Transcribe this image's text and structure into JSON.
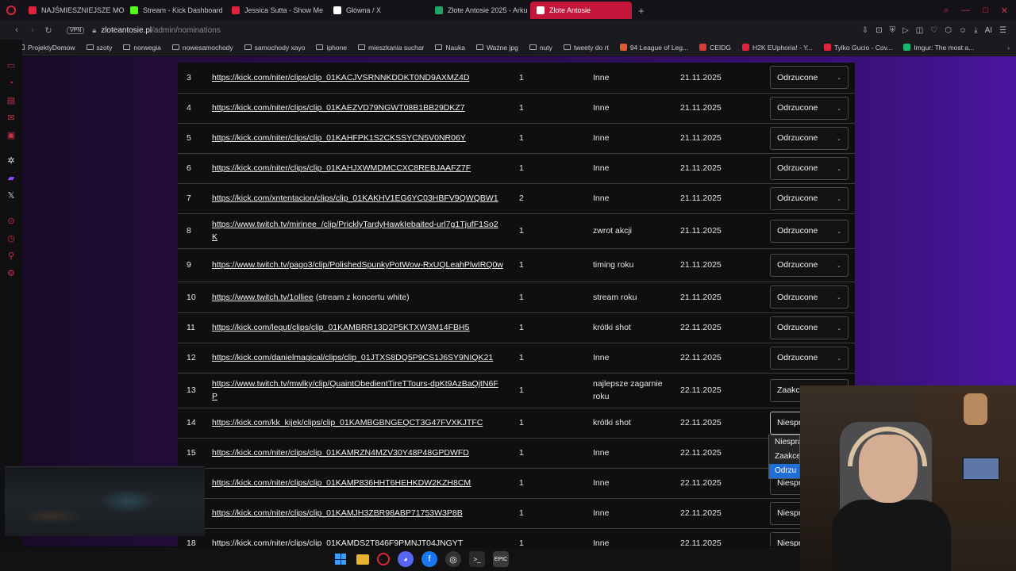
{
  "tabs": [
    {
      "label": "NAJŚMIESZNIEJSZE MOM",
      "color": "#e0223a"
    },
    {
      "label": "Stream - Kick Dashboard",
      "color": "#53fc18"
    },
    {
      "label": "Jessica Sutta - Show Me",
      "color": "#e0223a"
    },
    {
      "label": "Główna / X",
      "color": "#ffffff"
    },
    {
      "label": "Złote Antosie 2025 - Arku",
      "color": "#1fa463"
    },
    {
      "label": "Złote Antosie",
      "color": "#e0223a",
      "active": true
    }
  ],
  "address": {
    "vpn": "VPN",
    "domain": "zloteantosie.pl",
    "path": "/admin/nominations"
  },
  "address_icons": [
    "pin-icon",
    "screenshot-icon",
    "shield-icon",
    "play-icon",
    "camera-icon",
    "heart-icon",
    "extensions-icon",
    "profile-icon",
    "download-icon",
    "aria-ai-icon",
    "menu-icon"
  ],
  "address_ai": "AI",
  "bookmarks": [
    {
      "label": "ProjektyDomow",
      "type": "folder"
    },
    {
      "label": "szoty",
      "type": "folder"
    },
    {
      "label": "norwegia",
      "type": "folder"
    },
    {
      "label": "nowesamochody",
      "type": "folder"
    },
    {
      "label": "samochody xayo",
      "type": "folder"
    },
    {
      "label": "iphone",
      "type": "folder"
    },
    {
      "label": "mieszkania suchar",
      "type": "folder"
    },
    {
      "label": "Nauka",
      "type": "folder"
    },
    {
      "label": "Ważne jpg",
      "type": "folder"
    },
    {
      "label": "nuty",
      "type": "folder"
    },
    {
      "label": "tweety do rt",
      "type": "folder"
    },
    {
      "label": "94 League of Leg...",
      "type": "site",
      "color": "#e05a2b"
    },
    {
      "label": "CEIDG",
      "type": "site",
      "color": "#d93a3a"
    },
    {
      "label": "H2K EUphoria! - Y...",
      "type": "site",
      "color": "#e0223a"
    },
    {
      "label": "Tylko Gucio - Cov...",
      "type": "site",
      "color": "#e0223a"
    },
    {
      "label": "Imgur: The most a...",
      "type": "site",
      "color": "#1bb76e"
    }
  ],
  "rows": [
    {
      "num": "3",
      "url": "https://kick.com/niter/clips/clip_01KACJVSRNNKDDKT0ND9AXMZ4D",
      "extra": "",
      "votes": "1",
      "category": "Inne",
      "date": "21.11.2025",
      "status": "Odrzucone"
    },
    {
      "num": "4",
      "url": "https://kick.com/niter/clips/clip_01KAEZVD79NGWT08B1BB29DKZ7",
      "extra": "",
      "votes": "1",
      "category": "Inne",
      "date": "21.11.2025",
      "status": "Odrzucone"
    },
    {
      "num": "5",
      "url": "https://kick.com/niter/clips/clip_01KAHFPK1S2CKSSYCN5V0NR06Y",
      "extra": "",
      "votes": "1",
      "category": "Inne",
      "date": "21.11.2025",
      "status": "Odrzucone"
    },
    {
      "num": "6",
      "url": "https://kick.com/niter/clips/clip_01KAHJXWMDMCCXC8REBJAAFZ7F",
      "extra": "",
      "votes": "1",
      "category": "Inne",
      "date": "21.11.2025",
      "status": "Odrzucone"
    },
    {
      "num": "7",
      "url": "https://kick.com/xntentacion/clips/clip_01KAKHV1EG6YC03HBFV9QWQBW1",
      "extra": "",
      "votes": "2",
      "category": "Inne",
      "date": "21.11.2025",
      "status": "Odrzucone"
    },
    {
      "num": "8",
      "url": "https://www.twitch.tv/mirinee_/clip/PricklyTardyHawkIebaited-url7g1TjufF1So2K",
      "extra": "",
      "votes": "1",
      "category": "zwrot akcji",
      "date": "21.11.2025",
      "status": "Odrzucone"
    },
    {
      "num": "9",
      "url": "https://www.twitch.tv/pago3/clip/PolishedSpunkyPotWow-RxUQLeahPlwIRQ0w",
      "extra": "",
      "votes": "1",
      "category": "timing roku",
      "date": "21.11.2025",
      "status": "Odrzucone"
    },
    {
      "num": "10",
      "url": "https://www.twitch.tv/1olliee",
      "extra": " (stream z koncertu white)",
      "votes": "1",
      "category": "stream roku",
      "date": "21.11.2025",
      "status": "Odrzucone"
    },
    {
      "num": "11",
      "url": "https://kick.com/lequt/clips/clip_01KAMBRR13D2P5KTXW3M14FBH5",
      "extra": "",
      "votes": "1",
      "category": "krótki shot",
      "date": "22.11.2025",
      "status": "Odrzucone"
    },
    {
      "num": "12",
      "url": "https://kick.com/danielmagical/clips/clip_01JTXS8DQ5P9CS1J6SY9NIQK21",
      "extra": "",
      "votes": "1",
      "category": "Inne",
      "date": "22.11.2025",
      "status": "Odrzucone"
    },
    {
      "num": "13",
      "url": "https://www.twitch.tv/mwlky/clip/QuaintObedientTireTTours-dpKt9AzBaQjtN6FP",
      "extra": "",
      "votes": "1",
      "category": "najlepsze zagarnie roku",
      "date": "22.11.2025",
      "status": "Zaakcep"
    },
    {
      "num": "14",
      "url": "https://kick.com/kk_kijek/clips/clip_01KAMBGBNGEQCT3G47FVXKJTFC",
      "extra": "",
      "votes": "1",
      "category": "krótki shot",
      "date": "22.11.2025",
      "status": "Niespra",
      "focus": true
    },
    {
      "num": "15",
      "url": "https://kick.com/niter/clips/clip_01KAMRZN4MZV30Y48P48GPDWFD",
      "extra": "",
      "votes": "1",
      "category": "Inne",
      "date": "22.11.2025",
      "status": ""
    },
    {
      "num": "",
      "url": "https://kick.com/niter/clips/clip_01KAMP836HHT6HEHKDW2KZH8CM",
      "extra": "",
      "votes": "1",
      "category": "Inne",
      "date": "22.11.2025",
      "status": "Niespra"
    },
    {
      "num": "",
      "url": "https://kick.com/niter/clips/clip_01KAMJH3ZBR98ABP71753W3P8B",
      "extra": "",
      "votes": "1",
      "category": "Inne",
      "date": "22.11.2025",
      "status": "Niespra"
    },
    {
      "num": "18",
      "url": "https://kick.com/niter/clips/clip_01KAMDS2T846F9PMNJT04JNGYT",
      "extra": "",
      "votes": "1",
      "category": "Inne",
      "date": "22.11.2025",
      "status": "Niespra"
    }
  ],
  "dropdown": {
    "options": [
      "Niespra",
      "Zaakcep",
      "Odrzu"
    ],
    "selected_index": 2
  }
}
